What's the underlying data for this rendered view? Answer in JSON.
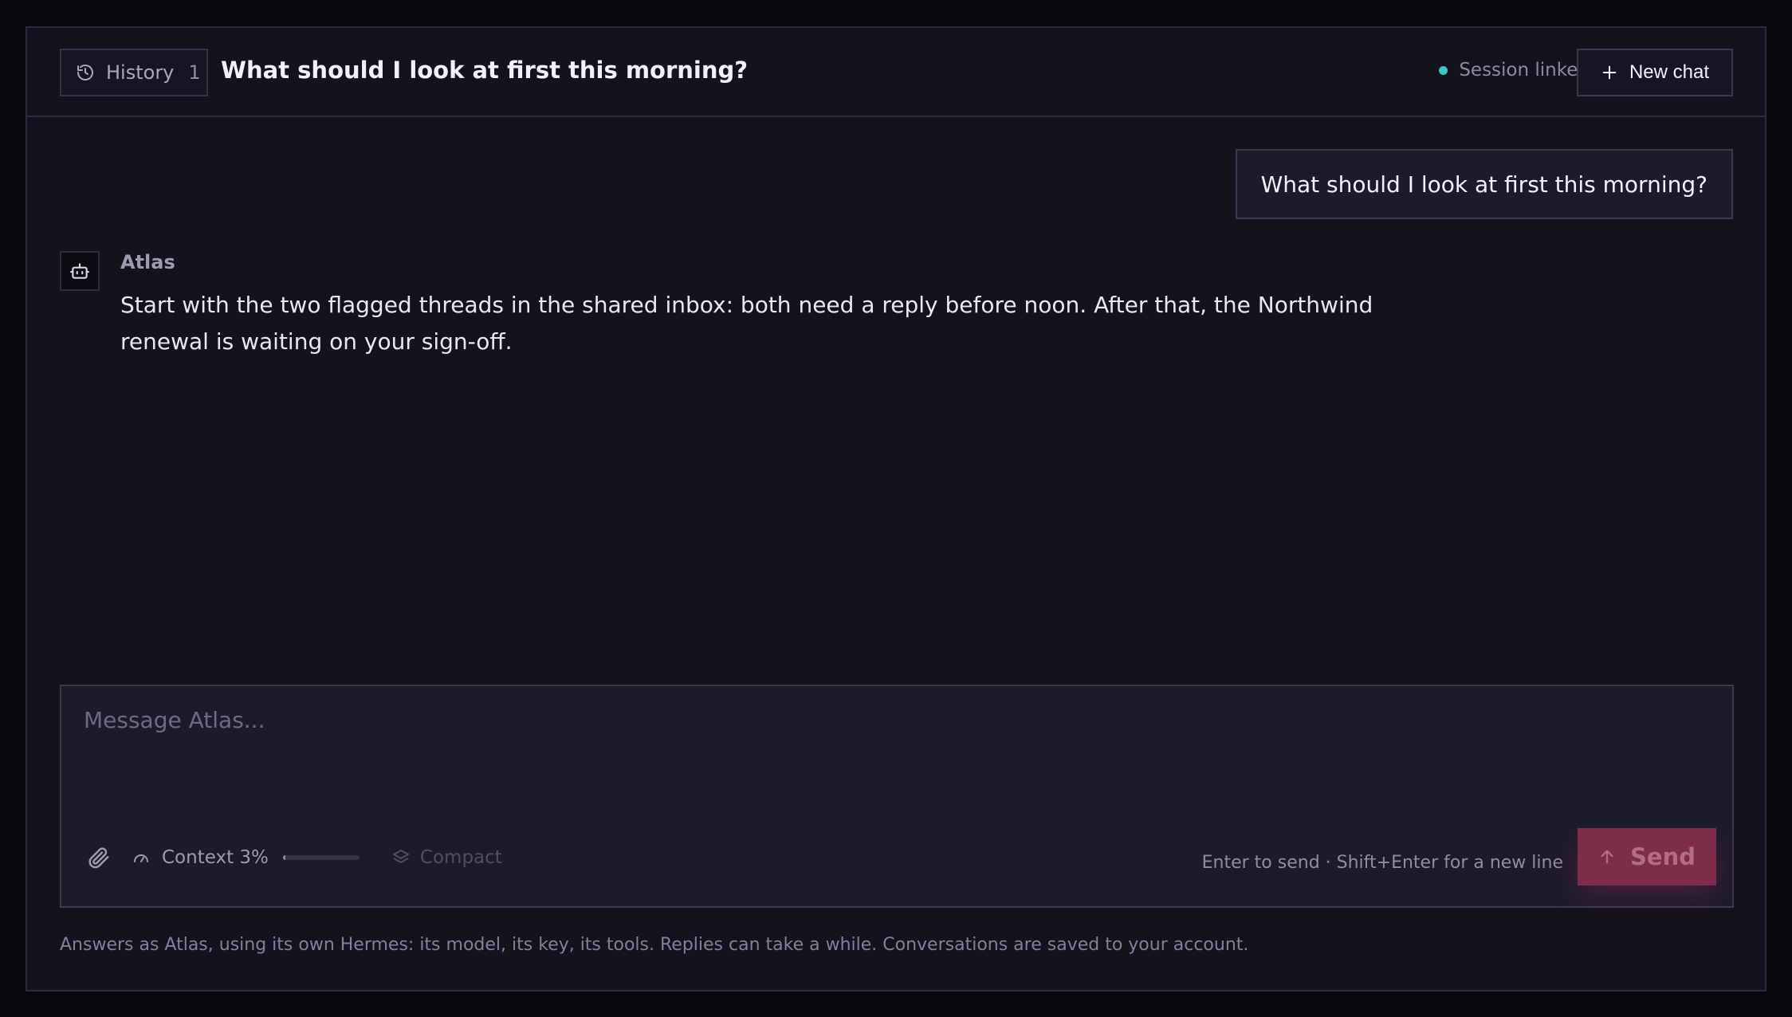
{
  "header": {
    "history_label": "History",
    "history_count": "1",
    "title": "What should I look at first this morning?",
    "session_status": "Session linked",
    "session_status_color": "#3ec6c0",
    "new_chat_label": "New chat"
  },
  "messages": [
    {
      "role": "user",
      "text": "What should I look at first this morning?"
    },
    {
      "role": "assistant",
      "author": "Atlas",
      "text": "Start with the two flagged threads in the shared inbox: both need a reply before noon. After that, the Northwind renewal is waiting on your sign-off."
    }
  ],
  "composer": {
    "value": "",
    "placeholder": "Message Atlas...",
    "context_label": "Context 3%",
    "context_fraction": 0.03,
    "compact_label": "Compact",
    "hint": "Enter to send · Shift+Enter for a new line",
    "send_label": "Send",
    "send_color": "#7d2c4a"
  },
  "footer": {
    "note": "Answers as Atlas, using its own Hermes: its model, its key, its tools. Replies can take a while. Conversations are saved to your account."
  },
  "icons": [
    "history-icon",
    "plus-icon",
    "bot-icon",
    "paperclip-icon",
    "gauge-icon",
    "layers-icon",
    "arrow-up-icon"
  ]
}
